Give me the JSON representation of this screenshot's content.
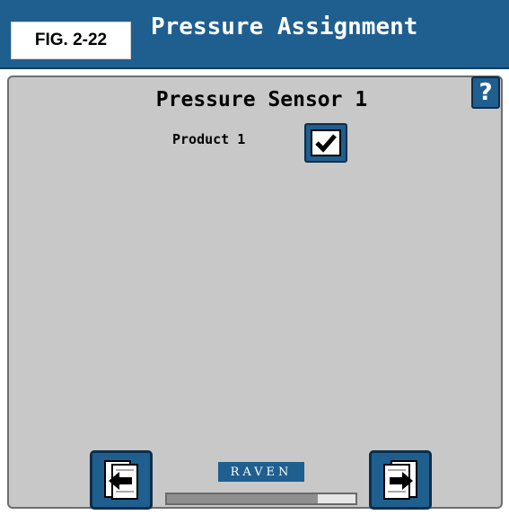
{
  "header": {
    "title": "Pressure Assignment",
    "figure_label": "FIG. 2-22",
    "color": "#1f5f8f"
  },
  "help": {
    "label": "?",
    "icon": "help-icon"
  },
  "main": {
    "sensor_title": "Pressure Sensor 1",
    "product_label": "Product 1",
    "product_checked": true
  },
  "footer": {
    "back_icon": "page-back-icon",
    "next_icon": "page-next-icon",
    "brand": "RAVEN",
    "progress_fraction": 0.8
  }
}
